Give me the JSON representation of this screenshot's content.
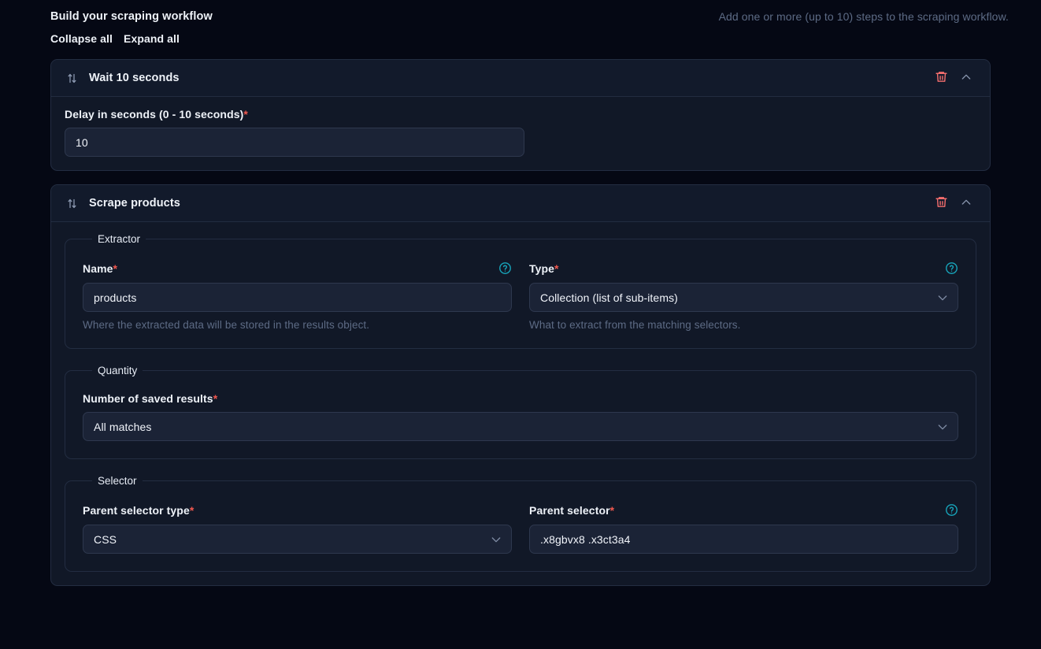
{
  "header": {
    "title": "Build your scraping workflow",
    "subtitle": "Add one or more (up to 10) steps to the scraping workflow.",
    "collapse_all": "Collapse all",
    "expand_all": "Expand all"
  },
  "steps": [
    {
      "title_prefix": "Wait ",
      "title_value": "10 seconds",
      "drag_icon": "sort-updown-icon",
      "delete_icon": "trash-icon",
      "collapse_icon": "chevron-up-icon",
      "delay": {
        "label": "Delay in seconds (0 - 10 seconds)",
        "required": "*",
        "value": "10",
        "placeholder": ""
      }
    },
    {
      "title_prefix": "Scrape ",
      "title_value": "products",
      "drag_icon": "sort-updown-icon",
      "delete_icon": "trash-icon",
      "collapse_icon": "chevron-up-icon",
      "extractor": {
        "legend": "Extractor",
        "name": {
          "label": "Name",
          "required": "*",
          "value": "products",
          "hint": "Where the extracted data will be stored in the results object.",
          "help_icon": "help-circle-icon"
        },
        "type": {
          "label": "Type",
          "required": "*",
          "value": "Collection (list of sub-items)",
          "hint": "What to extract from the matching selectors.",
          "help_icon": "help-circle-icon",
          "chevron": "chevron-down-icon"
        }
      },
      "quantity": {
        "legend": "Quantity",
        "saved_results": {
          "label": "Number of saved results",
          "required": "*",
          "value": "All matches",
          "chevron": "chevron-down-icon"
        }
      },
      "selector": {
        "legend": "Selector",
        "parent_selector_type": {
          "label": "Parent selector type",
          "required": "*",
          "value": "CSS",
          "chevron": "chevron-down-icon"
        },
        "parent_selector": {
          "label": "Parent selector",
          "required": "*",
          "value": ".x8gbvx8 .x3ct3a4",
          "help_icon": "help-circle-icon"
        }
      }
    }
  ],
  "colors": {
    "page_bg": "#050814",
    "card_bg": "#111827",
    "input_bg": "#1b2336",
    "border": "#232d42",
    "accent_danger": "#f26d6d",
    "accent_required": "#f0584f",
    "accent_help": "#17a2b8",
    "text_primary": "#eef2f8",
    "text_muted": "#5d6b85"
  }
}
